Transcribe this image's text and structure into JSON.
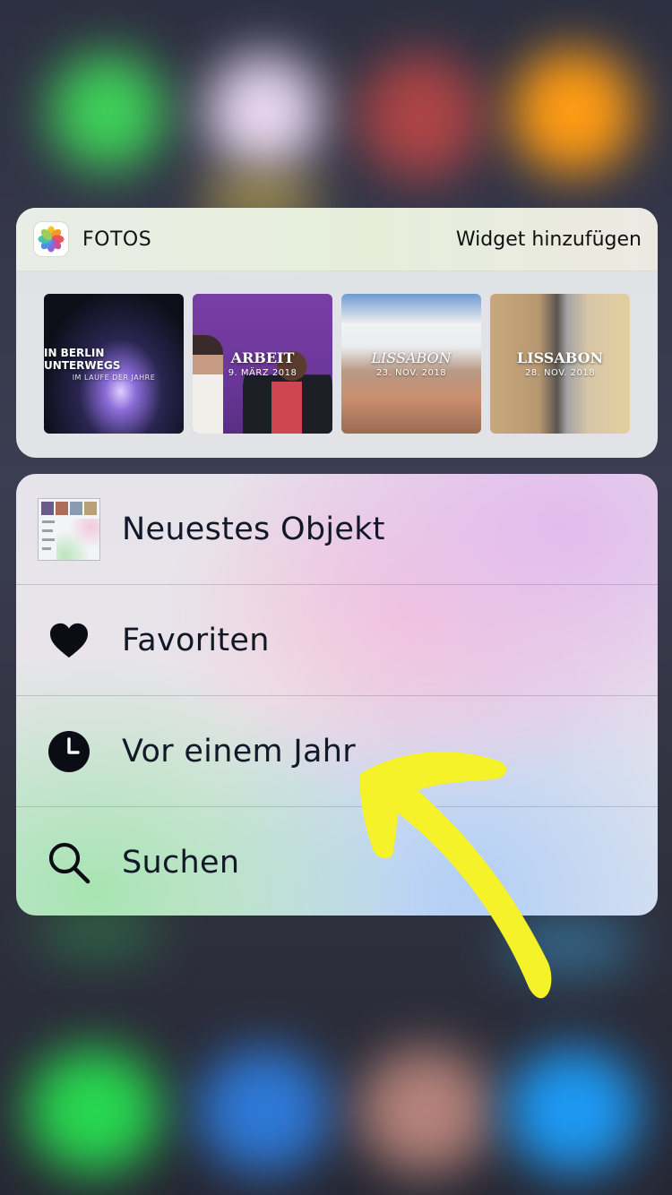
{
  "widget": {
    "app_name": "FOTOS",
    "add_widget_label": "Widget hinzufügen",
    "tiles": [
      {
        "title": "IN BERLIN UNTERWEGS",
        "subtitle": "IM LAUFE DER JAHRE"
      },
      {
        "title": "ARBEIT",
        "subtitle": "9. MÄRZ 2018"
      },
      {
        "title": "LISSABON",
        "subtitle": "23. NOV. 2018"
      },
      {
        "title": "LISSABON",
        "subtitle": "28. NOV. 2018"
      }
    ]
  },
  "menu": {
    "items": [
      {
        "label": "Neuestes Objekt",
        "icon": "recent-photo-thumbnail-icon"
      },
      {
        "label": "Favoriten",
        "icon": "heart-icon"
      },
      {
        "label": "Vor einem Jahr",
        "icon": "clock-icon"
      },
      {
        "label": "Suchen",
        "icon": "search-icon"
      }
    ]
  },
  "colors": {
    "annotation_arrow": "#f5f22a",
    "menu_text": "#111827"
  }
}
